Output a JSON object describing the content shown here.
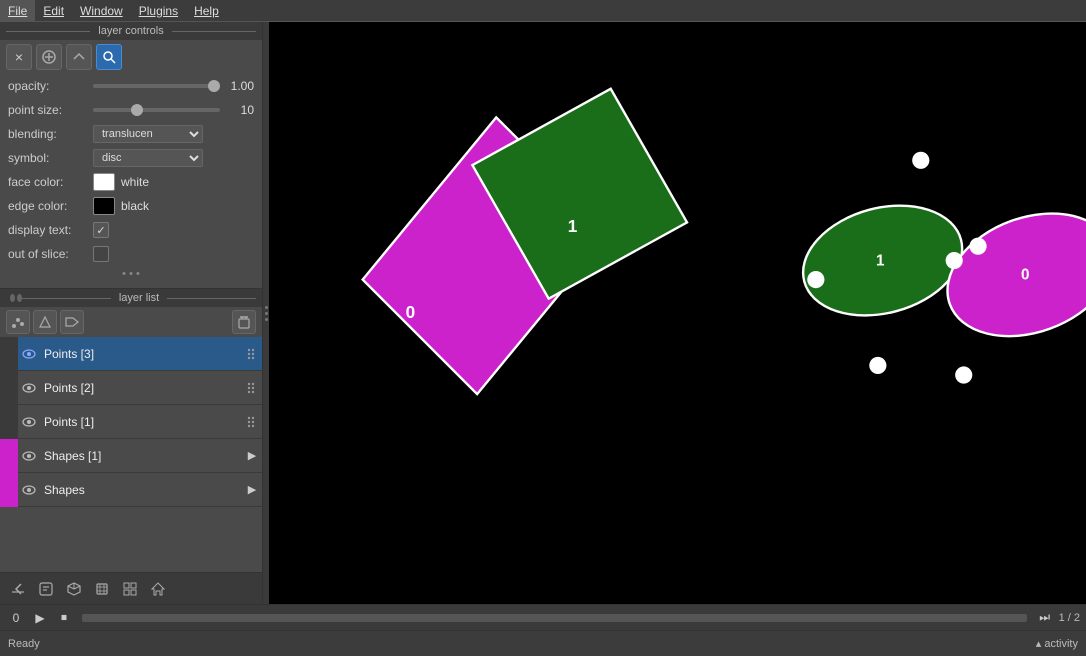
{
  "menubar": {
    "items": [
      "File",
      "Edit",
      "Window",
      "Plugins",
      "Help"
    ]
  },
  "layer_controls": {
    "title": "layer controls",
    "toolbar_buttons": [
      {
        "name": "clear-button",
        "label": "×"
      },
      {
        "name": "add-button",
        "label": "+"
      },
      {
        "name": "duplicate-button",
        "label": "↔"
      },
      {
        "name": "search-button",
        "label": "🔍"
      }
    ],
    "opacity": {
      "label": "opacity:",
      "value": "1.00",
      "slider_pct": 95
    },
    "point_size": {
      "label": "point size:",
      "value": "10",
      "slider_pct": 35
    },
    "blending": {
      "label": "blending:",
      "value": "translucen"
    },
    "symbol": {
      "label": "symbol:",
      "value": "disc"
    },
    "face_color": {
      "label": "face color:",
      "color": "#ffffff",
      "name": "white"
    },
    "edge_color": {
      "label": "edge color:",
      "color": "#000000",
      "name": "black"
    },
    "display_text": {
      "label": "display text:",
      "checked": true
    },
    "out_of_slice": {
      "label": "out of slice:",
      "checked": false
    }
  },
  "layer_list": {
    "title": "layer list",
    "layers": [
      {
        "name": "Points [3]",
        "color": "#3a3a3a",
        "eye": true,
        "active": true,
        "has_arrow": false
      },
      {
        "name": "Points [2]",
        "color": "#3a3a3a",
        "eye": true,
        "active": false,
        "has_arrow": false
      },
      {
        "name": "Points [1]",
        "color": "#3a3a3a",
        "eye": true,
        "active": false,
        "has_arrow": false
      },
      {
        "name": "Shapes [1]",
        "color": "#cc22cc",
        "eye": true,
        "active": false,
        "has_arrow": true
      },
      {
        "name": "Shapes",
        "color": "#cc22cc",
        "eye": true,
        "active": false,
        "has_arrow": true
      }
    ]
  },
  "bottom_tools": [
    "console",
    "script",
    "cube",
    "box",
    "grid",
    "home"
  ],
  "status": {
    "text": "Ready",
    "activity": "▴ activity"
  },
  "playback": {
    "frame": "0",
    "page": "1 / 2"
  },
  "canvas": {
    "shapes": [
      {
        "type": "parallelogram_magenta",
        "label": "0"
      },
      {
        "type": "parallelogram_green",
        "label": "1"
      },
      {
        "type": "ellipse_green",
        "label": "1"
      },
      {
        "type": "ellipse_magenta",
        "label": "0"
      }
    ]
  }
}
